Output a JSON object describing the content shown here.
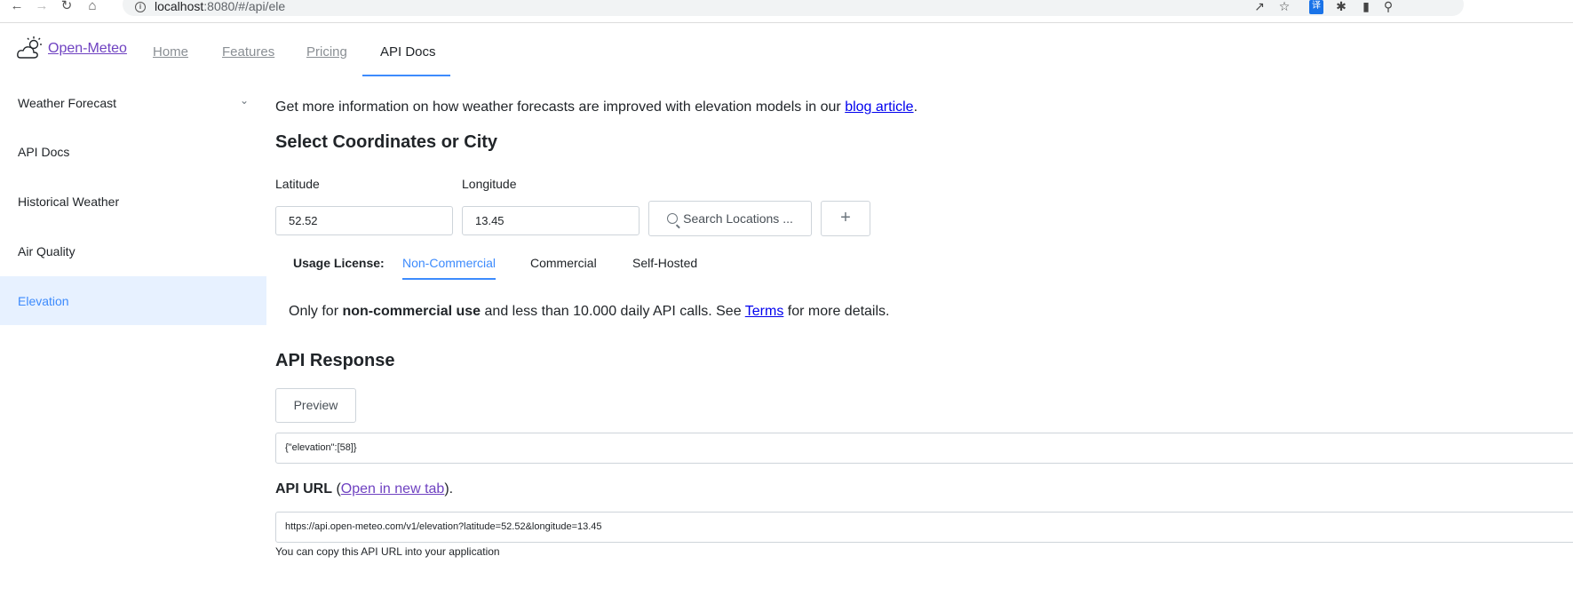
{
  "browser": {
    "url_host": "localhost",
    "url_rest": ":8080/#/api/ele"
  },
  "navbar": {
    "brand": "Open-Meteo",
    "links": [
      "Home",
      "Features",
      "Pricing",
      "API Docs"
    ],
    "active": "API Docs"
  },
  "sidebar": {
    "items": [
      {
        "label": "Weather Forecast",
        "has_chevron": true
      },
      {
        "label": "API Docs"
      },
      {
        "label": "Historical Weather"
      },
      {
        "label": "Air Quality"
      },
      {
        "label": "Elevation",
        "active": true
      }
    ]
  },
  "main": {
    "intro_text": "Get more information on how weather forecasts are improved with elevation models in our ",
    "intro_link": "blog article",
    "intro_end": ".",
    "select_heading": "Select Coordinates or City",
    "latitude_label": "Latitude",
    "latitude_value": "52.52",
    "longitude_label": "Longitude",
    "longitude_value": "13.45",
    "search_label": "Search Locations ...",
    "add_label": "+",
    "usage_label": "Usage License:",
    "tabs": [
      "Non-Commercial",
      "Commercial",
      "Self-Hosted"
    ],
    "active_tab": "Non-Commercial",
    "license_pre": "Only for ",
    "license_bold": "non-commercial use",
    "license_mid": " and less than 10.000 daily API calls. See ",
    "license_link": "Terms",
    "license_post": " for more details.",
    "response_heading": "API Response",
    "preview_label": "Preview",
    "response_json": "{\"elevation\":[58]}",
    "api_url_label": "API URL",
    "api_url_open_pre": " (",
    "api_url_open_link": "Open in new tab",
    "api_url_open_post": ").",
    "api_url": "https://api.open-meteo.com/v1/elevation?latitude=52.52&longitude=13.45",
    "api_url_hint": "You can copy this API URL into your application"
  },
  "colors": {
    "accent": "#3d8bfd",
    "active_bg": "#e7f1ff",
    "brand_link": "#6f42c1"
  }
}
